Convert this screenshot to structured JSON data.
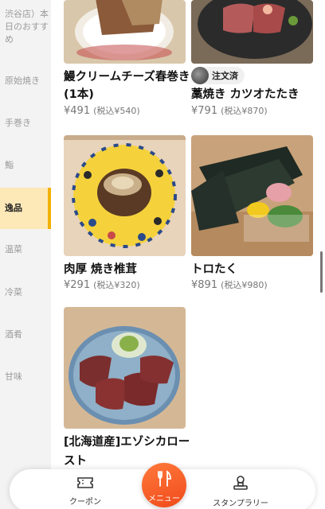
{
  "sidebar": {
    "items": [
      {
        "label": "渋谷店）本日のおすすめ",
        "active": false
      },
      {
        "label": "原始焼き",
        "active": false
      },
      {
        "label": "手巻き",
        "active": false
      },
      {
        "label": "鮨",
        "active": false
      },
      {
        "label": "逸品",
        "active": true
      },
      {
        "label": "温菜",
        "active": false
      },
      {
        "label": "冷菜",
        "active": false
      },
      {
        "label": "酒肴",
        "active": false
      },
      {
        "label": "甘味",
        "active": false
      }
    ]
  },
  "products": [
    {
      "name": "鰻クリームチーズ春巻き (1本)",
      "price": "¥491",
      "tax_price": "(税込¥540)"
    },
    {
      "name": "藁焼き カツオたたき",
      "price": "¥791",
      "tax_price": "(税込¥870)",
      "badge": "注文済"
    },
    {
      "name": "肉厚 焼き椎茸",
      "price": "¥291",
      "tax_price": "(税込¥320)"
    },
    {
      "name": "トロたく",
      "price": "¥891",
      "tax_price": "(税込¥980)"
    },
    {
      "name": "[北海道産]エゾシカロースト",
      "price": "",
      "tax_price": ""
    }
  ],
  "bottom_nav": {
    "coupon_label": "クーポン",
    "menu_label": "メニュー",
    "stamp_label": "スタンプラリー"
  },
  "colors": {
    "accent": "#f2b000",
    "fab": "#f04a1a"
  }
}
